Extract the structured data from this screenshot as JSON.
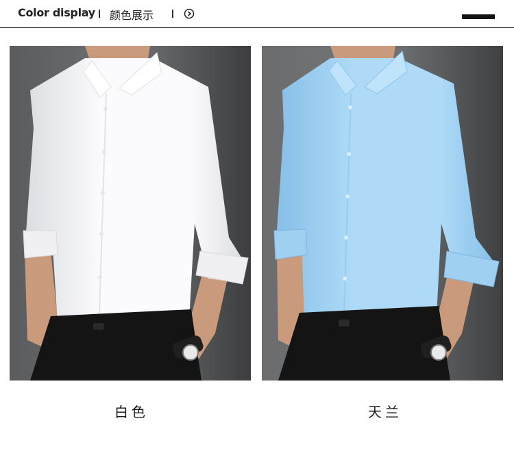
{
  "header": {
    "title_en": "Color display",
    "title_cn": "颜色展示",
    "icon": "play-circle-icon"
  },
  "products": [
    {
      "label": "白色",
      "shirt_color": "#fbfbfd",
      "shirt_shade": "#dcdde2",
      "collar_color": "#ffffff"
    },
    {
      "label": "天兰",
      "shirt_color": "#aedaf7",
      "shirt_shade": "#86bfe8",
      "collar_color": "#bfe3fa"
    }
  ],
  "colors": {
    "background_dark": "#4a4b4d",
    "pants": "#141414",
    "skin": "#c99a7c"
  }
}
